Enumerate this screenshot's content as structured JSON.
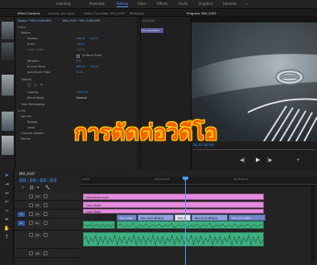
{
  "workspaces": [
    "Learning",
    "Assembly",
    "Editing",
    "Color",
    "Effects",
    "Audio",
    "Graphics",
    "Libraries"
  ],
  "active_workspace": "Editing",
  "panel_tabs": {
    "effect_controls": "Effect Controls",
    "source": "Source: (no clips)",
    "audio_clip_mixer": "Audio Clip Mixer: MVI_9167",
    "metadata": "Metadata",
    "program": "Program: MVI_9167"
  },
  "effect_controls": {
    "master": "Master * MVI_9169.MP4",
    "clip": "MVI_9167 * MVI_9169.MP4",
    "section_video": "Video",
    "motion": "Motion",
    "position_label": "Position",
    "position_x": "960.0",
    "position_y": "540.0",
    "scale_label": "Scale",
    "scale_value": "100.0",
    "scale_width_label": "Scale Width",
    "scale_width_value": "100.0",
    "uniform_scale": "Uniform Scale",
    "rotation_label": "Rotation",
    "rotation_value": "0.0",
    "anchor_label": "Anchor Point",
    "anchor_x": "960.0",
    "anchor_y": "540.0",
    "flicker_label": "Anti-flicker Filter",
    "flicker_value": "0.00",
    "opacity": "Opacity",
    "opacity_label": "Opacity",
    "opacity_value": "100.0 %",
    "blend_label": "Blend Mode",
    "blend_value": "Normal",
    "time_remap": "Time Remapping",
    "section_audio": "Audio",
    "volume": "Volume",
    "bypass": "Bypass",
    "level": "Level",
    "channel_volume": "Channel Volume",
    "panner": "Panner",
    "timecode_a": "00:00:00",
    "clip_label": "MVI_9169.MP4"
  },
  "overlay_title": "การตัดต่อวิดีโอ",
  "program_timecode": "00:00:06:09",
  "timeline": {
    "tab": "MVI_9167",
    "timecode": "00:00:06:09",
    "ruler_labels": [
      "00:00",
      "00:00:04:23",
      "00:00:09:23"
    ],
    "video_tracks": [
      "V3",
      "V2",
      "V1"
    ],
    "audio_tracks": [
      "A1",
      "A2",
      "A3"
    ],
    "clips": {
      "adjustment": "Adjustment Layer",
      "color_matte_1": "Color Matte",
      "color_matte_2": "Color Matte",
      "v1_a": "MVI_9168",
      "v1_b": "MVI_9167.MP4[V]",
      "v1_c": "MVI_9",
      "v1_d": "MVI_9170.MP4[V]",
      "v1_e": "MVI_9171.MP4"
    }
  },
  "colors": {
    "accent": "#4e9dff",
    "title_fill": "#ff5a00",
    "title_outline": "#ffe000",
    "clip_pink": "#e38bdc",
    "clip_blue": "#6f86c8",
    "clip_audio": "#3fae80"
  }
}
